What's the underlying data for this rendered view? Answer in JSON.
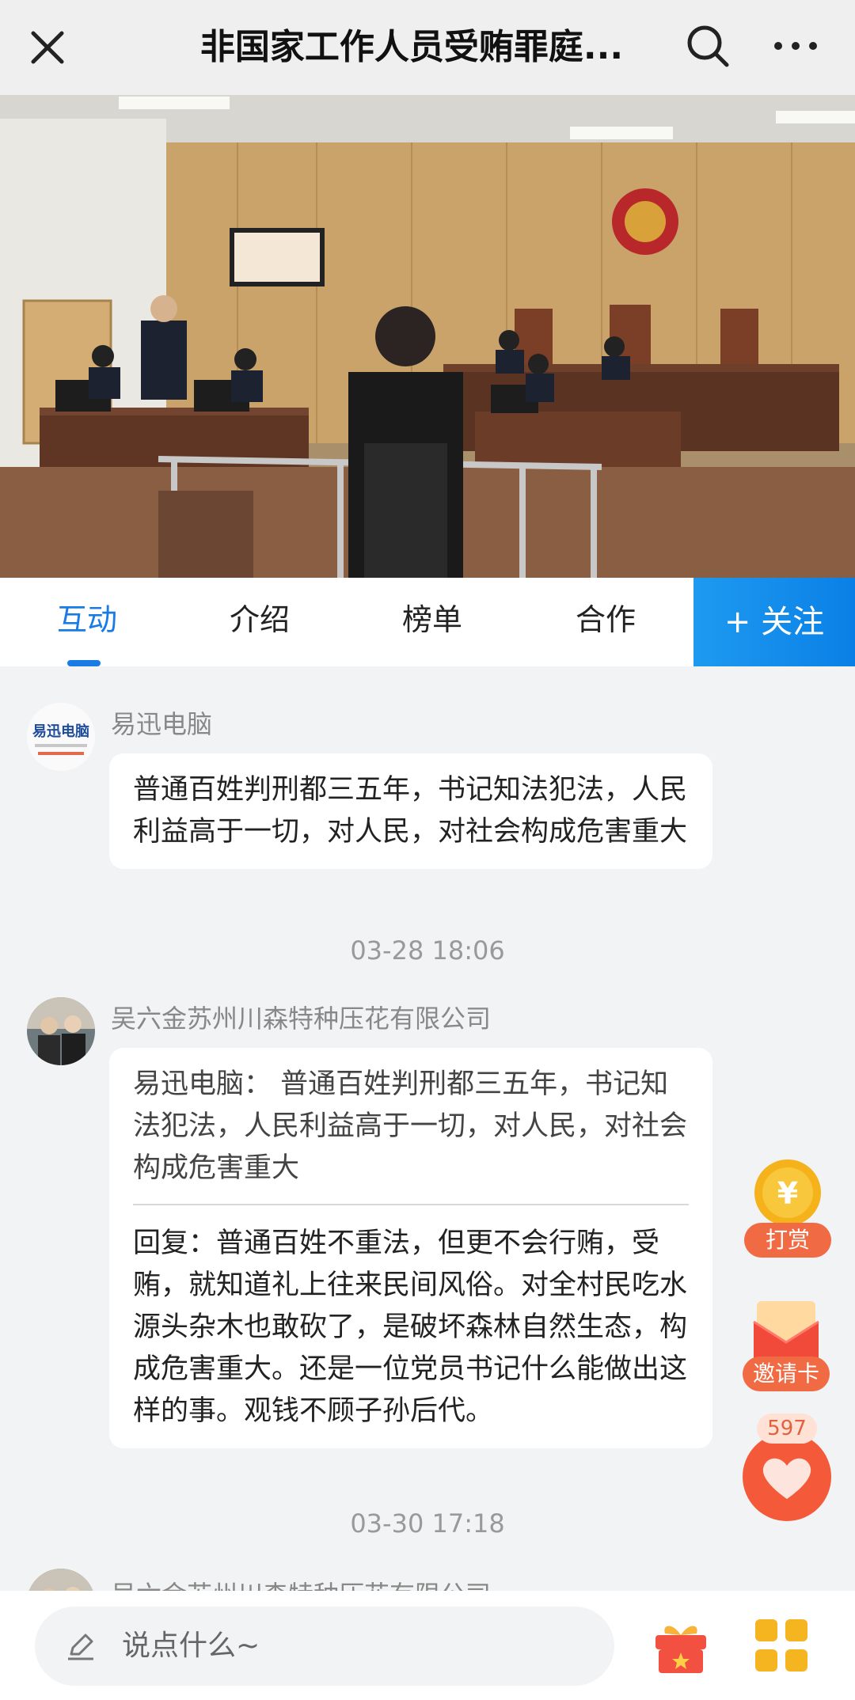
{
  "header": {
    "title": "非国家工作人员受贿罪庭...",
    "icons": {
      "close": "close-icon",
      "search": "search-icon",
      "more": "more-icon"
    }
  },
  "tabs": [
    {
      "label": "互动",
      "active": true
    },
    {
      "label": "介绍",
      "active": false
    },
    {
      "label": "榜单",
      "active": false
    },
    {
      "label": "合作",
      "active": false
    }
  ],
  "follow_label": "+ 关注",
  "comments": [
    {
      "user": "易迅电脑",
      "avatar_text": "易迅电脑",
      "text": "普通百姓判刑都三五年，书记知法犯法，人民利益高于一切，对人民，对社会构成危害重大",
      "time": "03-28 18:06"
    },
    {
      "user": "吴六金苏州川森特种压花有限公司",
      "quote": "易迅电脑： 普通百姓判刑都三五年，书记知法犯法，人民利益高于一切，对人民，对社会构成危害重大",
      "text": "回复：普通百姓不重法，但更不会行贿，受贿，就知道礼上往来民间风俗。对全村民吃水源头杂木也敢砍了，是破坏森林自然生态，构成危害重大。还是一位党员书记什么能做出这样的事。观钱不顾子孙后代。",
      "time": "03-30 17:18"
    },
    {
      "user": "吴六金苏州川森特种压花有限公司"
    }
  ],
  "floating": {
    "reward_label": "打赏",
    "invite_label": "邀请卡",
    "like_count": "597"
  },
  "bottom": {
    "input_placeholder": "说点什么~"
  },
  "colors": {
    "accent": "#1a7be5",
    "follow_bg": "#0a80e6",
    "reward": "#f06a43"
  }
}
